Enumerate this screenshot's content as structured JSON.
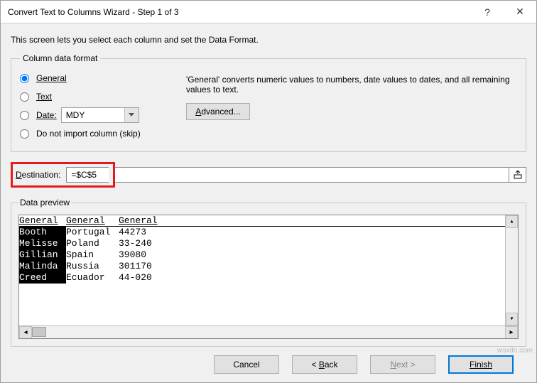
{
  "titlebar": {
    "title": "Convert Text to Columns Wizard - Step 1 of 3",
    "help": "?",
    "close": "✕"
  },
  "instruction": "This screen lets you select each column and set the Data Format.",
  "format_group": {
    "legend": "Column data format",
    "general": "General",
    "text": "Text",
    "date": "Date:",
    "date_value": "MDY",
    "skip": "Do not import column (skip)",
    "description": "'General' converts numeric values to numbers, date values to dates, and all remaining values to text.",
    "advanced": "Advanced..."
  },
  "destination": {
    "label": "Destination:",
    "value": "=$C$5"
  },
  "preview": {
    "legend": "Data preview",
    "headers": [
      "General",
      "General",
      "General"
    ],
    "rows": [
      [
        "Booth",
        "Portugal",
        "44273"
      ],
      [
        "Melisse",
        "Poland",
        "33-240"
      ],
      [
        "Gillian",
        "Spain",
        "39080"
      ],
      [
        "Malinda",
        "Russia",
        "301170"
      ],
      [
        "Creed",
        "Ecuador",
        "44-020"
      ]
    ]
  },
  "footer": {
    "cancel": "Cancel",
    "back": "< Back",
    "next": "Next >",
    "finish": "Finish"
  },
  "watermark": "wsxdn.com"
}
